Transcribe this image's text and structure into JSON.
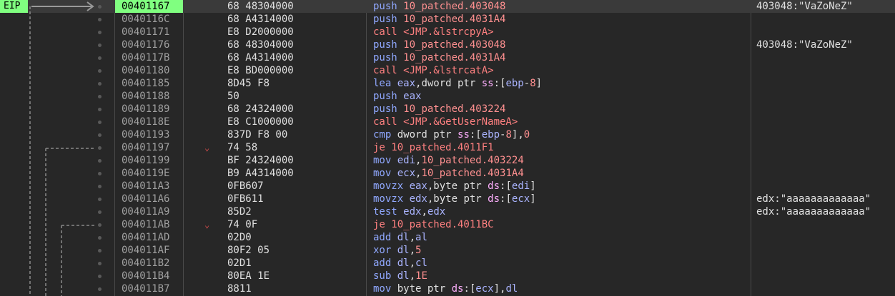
{
  "eip_label": "EIP",
  "colors": {
    "background": "#272727",
    "eip_highlight": "#80ff80",
    "mnemonic": "#90a8ff",
    "call_jump": "#ff8080",
    "number": "#ff9090",
    "segment": "#ffb0ff",
    "jump_arrow": "#d24b4b"
  },
  "rows": [
    {
      "addr": "00401167",
      "bytes": "68 48304000",
      "instr": [
        [
          "mn",
          "push "
        ],
        [
          "num",
          "10_patched.403048"
        ]
      ],
      "comment": "403048:\"VaZoNeZ\""
    },
    {
      "addr": "0040116C",
      "bytes": "68 A4314000",
      "instr": [
        [
          "mn",
          "push "
        ],
        [
          "num",
          "10_patched.4031A4"
        ]
      ],
      "comment": ""
    },
    {
      "addr": "00401171",
      "bytes": "E8 D2000000",
      "instr": [
        [
          "call",
          "call <JMP.&lstrcpyA>"
        ]
      ],
      "comment": ""
    },
    {
      "addr": "00401176",
      "bytes": "68 48304000",
      "instr": [
        [
          "mn",
          "push "
        ],
        [
          "num",
          "10_patched.403048"
        ]
      ],
      "comment": "403048:\"VaZoNeZ\""
    },
    {
      "addr": "0040117B",
      "bytes": "68 A4314000",
      "instr": [
        [
          "mn",
          "push "
        ],
        [
          "num",
          "10_patched.4031A4"
        ]
      ],
      "comment": ""
    },
    {
      "addr": "00401180",
      "bytes": "E8 BD000000",
      "instr": [
        [
          "call",
          "call <JMP.&lstrcatA>"
        ]
      ],
      "comment": ""
    },
    {
      "addr": "00401185",
      "bytes": "8D45 F8",
      "instr": [
        [
          "mn",
          "lea "
        ],
        [
          "reg",
          "eax"
        ],
        [
          "tx",
          ",dword ptr "
        ],
        [
          "seg",
          "ss"
        ],
        [
          "tx",
          ":["
        ],
        [
          "reg",
          "ebp"
        ],
        [
          "tx",
          "-"
        ],
        [
          "num",
          "8"
        ],
        [
          "tx",
          "]"
        ]
      ],
      "comment": ""
    },
    {
      "addr": "00401188",
      "bytes": "50",
      "instr": [
        [
          "mn",
          "push "
        ],
        [
          "reg",
          "eax"
        ]
      ],
      "comment": ""
    },
    {
      "addr": "00401189",
      "bytes": "68 24324000",
      "instr": [
        [
          "mn",
          "push "
        ],
        [
          "num",
          "10_patched.403224"
        ]
      ],
      "comment": ""
    },
    {
      "addr": "0040118E",
      "bytes": "E8 C1000000",
      "instr": [
        [
          "call",
          "call <JMP.&GetUserNameA>"
        ]
      ],
      "comment": ""
    },
    {
      "addr": "00401193",
      "bytes": "837D F8 00",
      "instr": [
        [
          "mn",
          "cmp "
        ],
        [
          "tx",
          "dword ptr "
        ],
        [
          "seg",
          "ss"
        ],
        [
          "tx",
          ":["
        ],
        [
          "reg",
          "ebp"
        ],
        [
          "tx",
          "-"
        ],
        [
          "num",
          "8"
        ],
        [
          "tx",
          "],"
        ],
        [
          "num",
          "0"
        ]
      ],
      "comment": ""
    },
    {
      "addr": "00401197",
      "bytes": "74 58",
      "instr": [
        [
          "jmp",
          "je 10_patched.4011F1"
        ]
      ],
      "comment": ""
    },
    {
      "addr": "00401199",
      "bytes": "BF 24324000",
      "instr": [
        [
          "mn",
          "mov "
        ],
        [
          "reg",
          "edi"
        ],
        [
          "tx",
          ","
        ],
        [
          "num",
          "10_patched.403224"
        ]
      ],
      "comment": ""
    },
    {
      "addr": "0040119E",
      "bytes": "B9 A4314000",
      "instr": [
        [
          "mn",
          "mov "
        ],
        [
          "reg",
          "ecx"
        ],
        [
          "tx",
          ","
        ],
        [
          "num",
          "10_patched.4031A4"
        ]
      ],
      "comment": ""
    },
    {
      "addr": "004011A3",
      "bytes": "0FB607",
      "instr": [
        [
          "mn",
          "movzx "
        ],
        [
          "reg",
          "eax"
        ],
        [
          "tx",
          ",byte ptr "
        ],
        [
          "seg",
          "ds"
        ],
        [
          "tx",
          ":["
        ],
        [
          "reg",
          "edi"
        ],
        [
          "tx",
          "]"
        ]
      ],
      "comment": ""
    },
    {
      "addr": "004011A6",
      "bytes": "0FB611",
      "instr": [
        [
          "mn",
          "movzx "
        ],
        [
          "reg",
          "edx"
        ],
        [
          "tx",
          ",byte ptr "
        ],
        [
          "seg",
          "ds"
        ],
        [
          "tx",
          ":["
        ],
        [
          "reg",
          "ecx"
        ],
        [
          "tx",
          "]"
        ]
      ],
      "comment": "edx:\"aaaaaaaaaaaaa\""
    },
    {
      "addr": "004011A9",
      "bytes": "85D2",
      "instr": [
        [
          "mn",
          "test "
        ],
        [
          "reg",
          "edx"
        ],
        [
          "tx",
          ","
        ],
        [
          "reg",
          "edx"
        ]
      ],
      "comment": "edx:\"aaaaaaaaaaaaa\""
    },
    {
      "addr": "004011AB",
      "bytes": "74 0F",
      "instr": [
        [
          "jmp",
          "je 10_patched.4011BC"
        ]
      ],
      "comment": ""
    },
    {
      "addr": "004011AD",
      "bytes": "02D0",
      "instr": [
        [
          "mn",
          "add "
        ],
        [
          "reg",
          "dl"
        ],
        [
          "tx",
          ","
        ],
        [
          "reg",
          "al"
        ]
      ],
      "comment": ""
    },
    {
      "addr": "004011AF",
      "bytes": "80F2 05",
      "instr": [
        [
          "mn",
          "xor "
        ],
        [
          "reg",
          "dl"
        ],
        [
          "tx",
          ","
        ],
        [
          "num",
          "5"
        ]
      ],
      "comment": ""
    },
    {
      "addr": "004011B2",
      "bytes": "02D1",
      "instr": [
        [
          "mn",
          "add "
        ],
        [
          "reg",
          "dl"
        ],
        [
          "tx",
          ","
        ],
        [
          "reg",
          "cl"
        ]
      ],
      "comment": ""
    },
    {
      "addr": "004011B4",
      "bytes": "80EA 1E",
      "instr": [
        [
          "mn",
          "sub "
        ],
        [
          "reg",
          "dl"
        ],
        [
          "tx",
          ","
        ],
        [
          "num",
          "1E"
        ]
      ],
      "comment": ""
    },
    {
      "addr": "004011B7",
      "bytes": "8811",
      "instr": [
        [
          "mn",
          "mov "
        ],
        [
          "tx",
          "byte ptr "
        ],
        [
          "seg",
          "ds"
        ],
        [
          "tx",
          ":["
        ],
        [
          "reg",
          "ecx"
        ],
        [
          "tx",
          "],"
        ],
        [
          "reg",
          "dl"
        ]
      ],
      "comment": ""
    }
  ],
  "current_index": 0,
  "jump_rows": [
    11,
    17
  ]
}
